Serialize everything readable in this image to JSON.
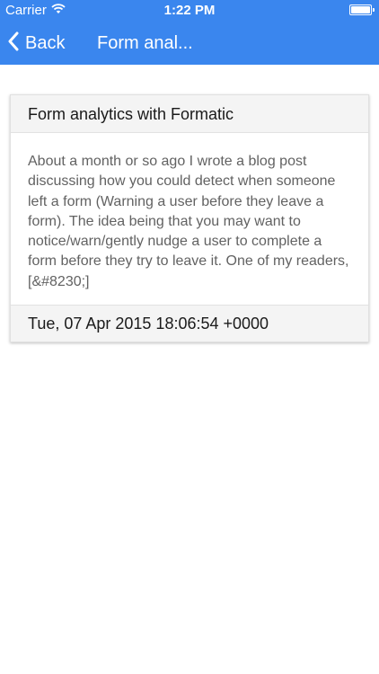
{
  "status_bar": {
    "carrier": "Carrier",
    "time": "1:22 PM",
    "wifi_icon": "wifi-icon",
    "battery_icon": "battery-icon"
  },
  "nav": {
    "back_label": "Back",
    "back_icon": "chevron-left-icon",
    "title": "Form anal..."
  },
  "post": {
    "title": "Form analytics with Formatic",
    "excerpt": "About a month or so ago I wrote a blog post discussing how you could detect when someone left a form (Warning a user before they leave a form). The idea being that you may want to notice/warn/gently nudge a user to complete a form before they try to leave it. One of my readers, [&#8230;]",
    "date": "Tue, 07 Apr 2015 18:06:54 +0000"
  },
  "colors": {
    "header_bg": "#3a86ee",
    "card_section_bg": "#f4f4f4",
    "body_text": "#626262"
  }
}
